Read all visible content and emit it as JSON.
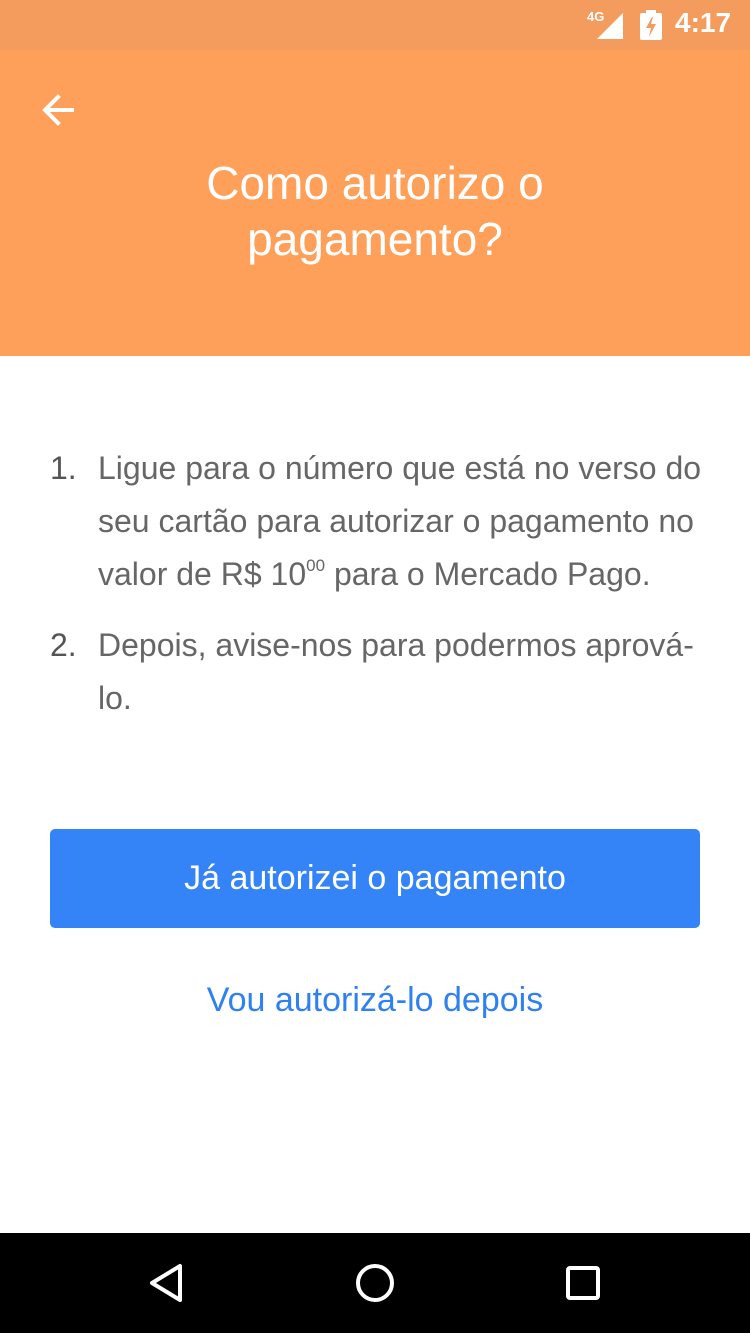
{
  "status_bar": {
    "network": "4G",
    "time": "4:17",
    "icons": [
      "signal-icon",
      "battery-charging-icon"
    ]
  },
  "header": {
    "back_icon": "arrow-left-icon",
    "title_line1": "Como autorizo o",
    "title_line2": "pagamento?"
  },
  "steps": [
    {
      "number": "1.",
      "text_before": "Ligue para o número que está no verso do seu cartão para autorizar o pagamento no valor de R$ 10",
      "cents": "00",
      "text_after": " para o Mercado Pago."
    },
    {
      "number": "2.",
      "text": "Depois, avise-nos para podermos aprová-lo."
    }
  ],
  "actions": {
    "primary_label": "Já autorizei o pagamento",
    "secondary_label": "Vou autorizá-lo depois"
  },
  "nav_bar": {
    "icons": [
      "nav-back-icon",
      "nav-home-icon",
      "nav-recents-icon"
    ]
  },
  "colors": {
    "status_bar": "#f49b5e",
    "header": "#fea059",
    "primary_button": "#3484f8",
    "link": "#2f80f0",
    "body_text": "#666666"
  }
}
